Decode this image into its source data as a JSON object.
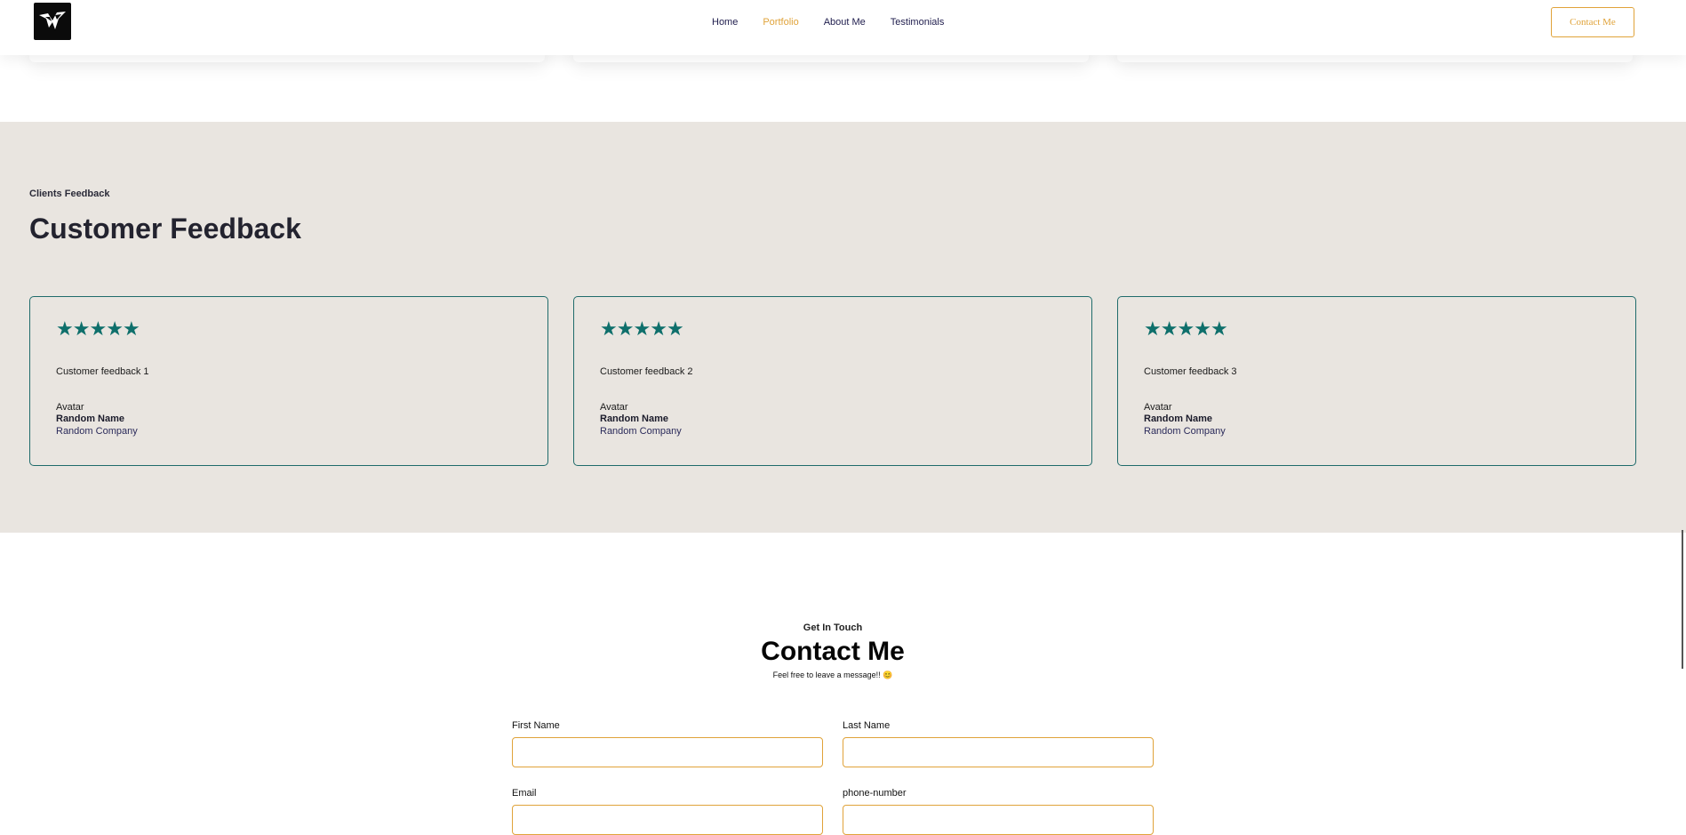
{
  "header": {
    "logo": "falcon-logo",
    "nav": [
      {
        "label": "Home",
        "active": false
      },
      {
        "label": "Portfolio",
        "active": true
      },
      {
        "label": "About Me",
        "active": false
      },
      {
        "label": "Testimonials",
        "active": false
      }
    ],
    "contact_button": "Contact Me"
  },
  "feedback": {
    "eyebrow": "Clients Feedback",
    "title": "Customer Feedback",
    "cards": [
      {
        "stars": 5,
        "text": "Customer feedback 1",
        "avatar": "Avatar",
        "name": "Random Name",
        "company": "Random Company"
      },
      {
        "stars": 5,
        "text": "Customer feedback 2",
        "avatar": "Avatar",
        "name": "Random Name",
        "company": "Random Company"
      },
      {
        "stars": 5,
        "text": "Customer feedback 3",
        "avatar": "Avatar",
        "name": "Random Name",
        "company": "Random Company"
      }
    ]
  },
  "contact": {
    "eyebrow": "Get In Touch",
    "title": "Contact Me",
    "subtitle": "Feel free to leave a message!! 😊",
    "fields": {
      "first_name": "First Name",
      "last_name": "Last Name",
      "email": "Email",
      "phone": "phone-number"
    }
  },
  "colors": {
    "accent": "#e0a33a",
    "teal": "#0e6f6b",
    "section_bg": "#e9e5e0",
    "nav_text": "#1f1d4d"
  }
}
